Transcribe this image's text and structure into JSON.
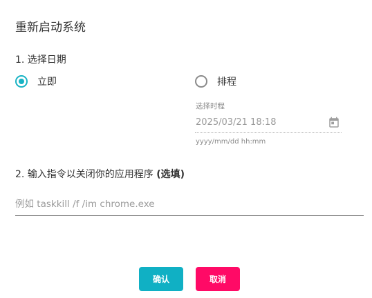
{
  "dialog": {
    "title": "重新启动系统"
  },
  "date_section": {
    "label": "1. 选择日期",
    "options": [
      {
        "label": "立即",
        "selected": true
      },
      {
        "label": "排程",
        "selected": false
      }
    ],
    "schedule": {
      "caption": "选择时程",
      "value": "2025/03/21 18:18",
      "format_hint": "yyyy/mm/dd hh:mm",
      "icon": "calendar-icon"
    }
  },
  "command_section": {
    "label": "2. 输入指令以关闭你的应用程序",
    "optional_label": "(选填)",
    "placeholder": "例如 taskkill /f /im chrome.exe",
    "value": ""
  },
  "buttons": {
    "confirm": "确认",
    "cancel": "取消"
  },
  "colors": {
    "accent": "#10b0c4",
    "danger": "#ff0a66"
  }
}
